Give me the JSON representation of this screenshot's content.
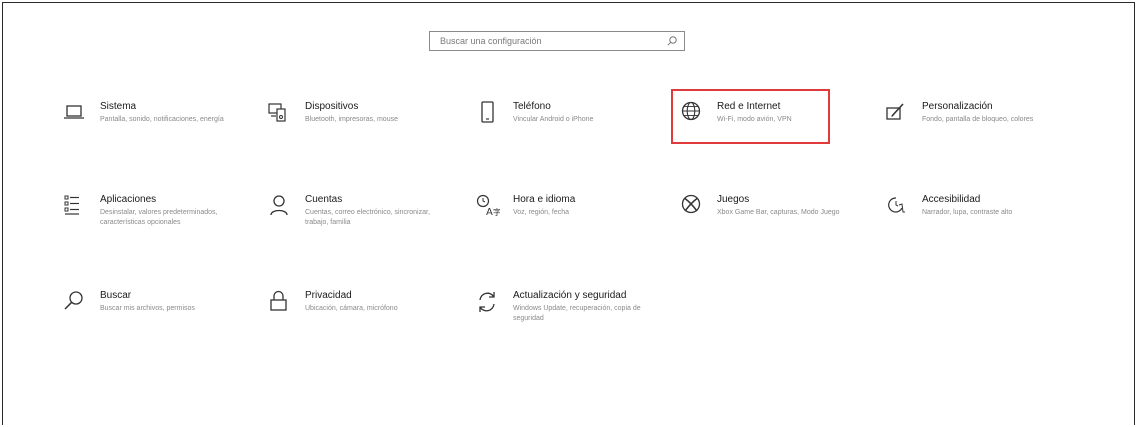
{
  "search": {
    "placeholder": "Buscar una configuración",
    "icon": "search-icon"
  },
  "tiles": [
    {
      "title": "Sistema",
      "desc": "Pantalla, sonido, notificaciones, energía",
      "icon": "laptop-icon"
    },
    {
      "title": "Dispositivos",
      "desc": "Bluetooth, impresoras, mouse",
      "icon": "devices-icon"
    },
    {
      "title": "Teléfono",
      "desc": "Vincular Android o iPhone",
      "icon": "phone-icon"
    },
    {
      "title": "Red e Internet",
      "desc": "Wi-Fi, modo avión, VPN",
      "icon": "globe-icon"
    },
    {
      "title": "Personalización",
      "desc": "Fondo, pantalla de bloqueo, colores",
      "icon": "personalization-icon"
    },
    {
      "title": "Aplicaciones",
      "desc": "Desinstalar, valores predeterminados, características opcionales",
      "icon": "apps-list-icon"
    },
    {
      "title": "Cuentas",
      "desc": "Cuentas, correo electrónico, sincronizar, trabajo, familia",
      "icon": "person-icon"
    },
    {
      "title": "Hora e idioma",
      "desc": "Voz, región, fecha",
      "icon": "time-language-icon"
    },
    {
      "title": "Juegos",
      "desc": "Xbox Game Bar, capturas, Modo Juego",
      "icon": "xbox-icon"
    },
    {
      "title": "Accesibilidad",
      "desc": "Narrador, lupa, contraste alto",
      "icon": "accessibility-icon"
    },
    {
      "title": "Buscar",
      "desc": "Buscar mis archivos, permisos",
      "icon": "magnifier-icon"
    },
    {
      "title": "Privacidad",
      "desc": "Ubicación, cámara, micrófono",
      "icon": "lock-icon"
    },
    {
      "title": "Actualización y seguridad",
      "desc": "Windows Update, recuperación, copia de seguridad",
      "icon": "sync-icon"
    }
  ],
  "highlighted_tile": "Red e Internet",
  "colors": {
    "highlight_border": "#e03a3a",
    "text": "#1a1a1a",
    "description": "#8a8a8a"
  }
}
